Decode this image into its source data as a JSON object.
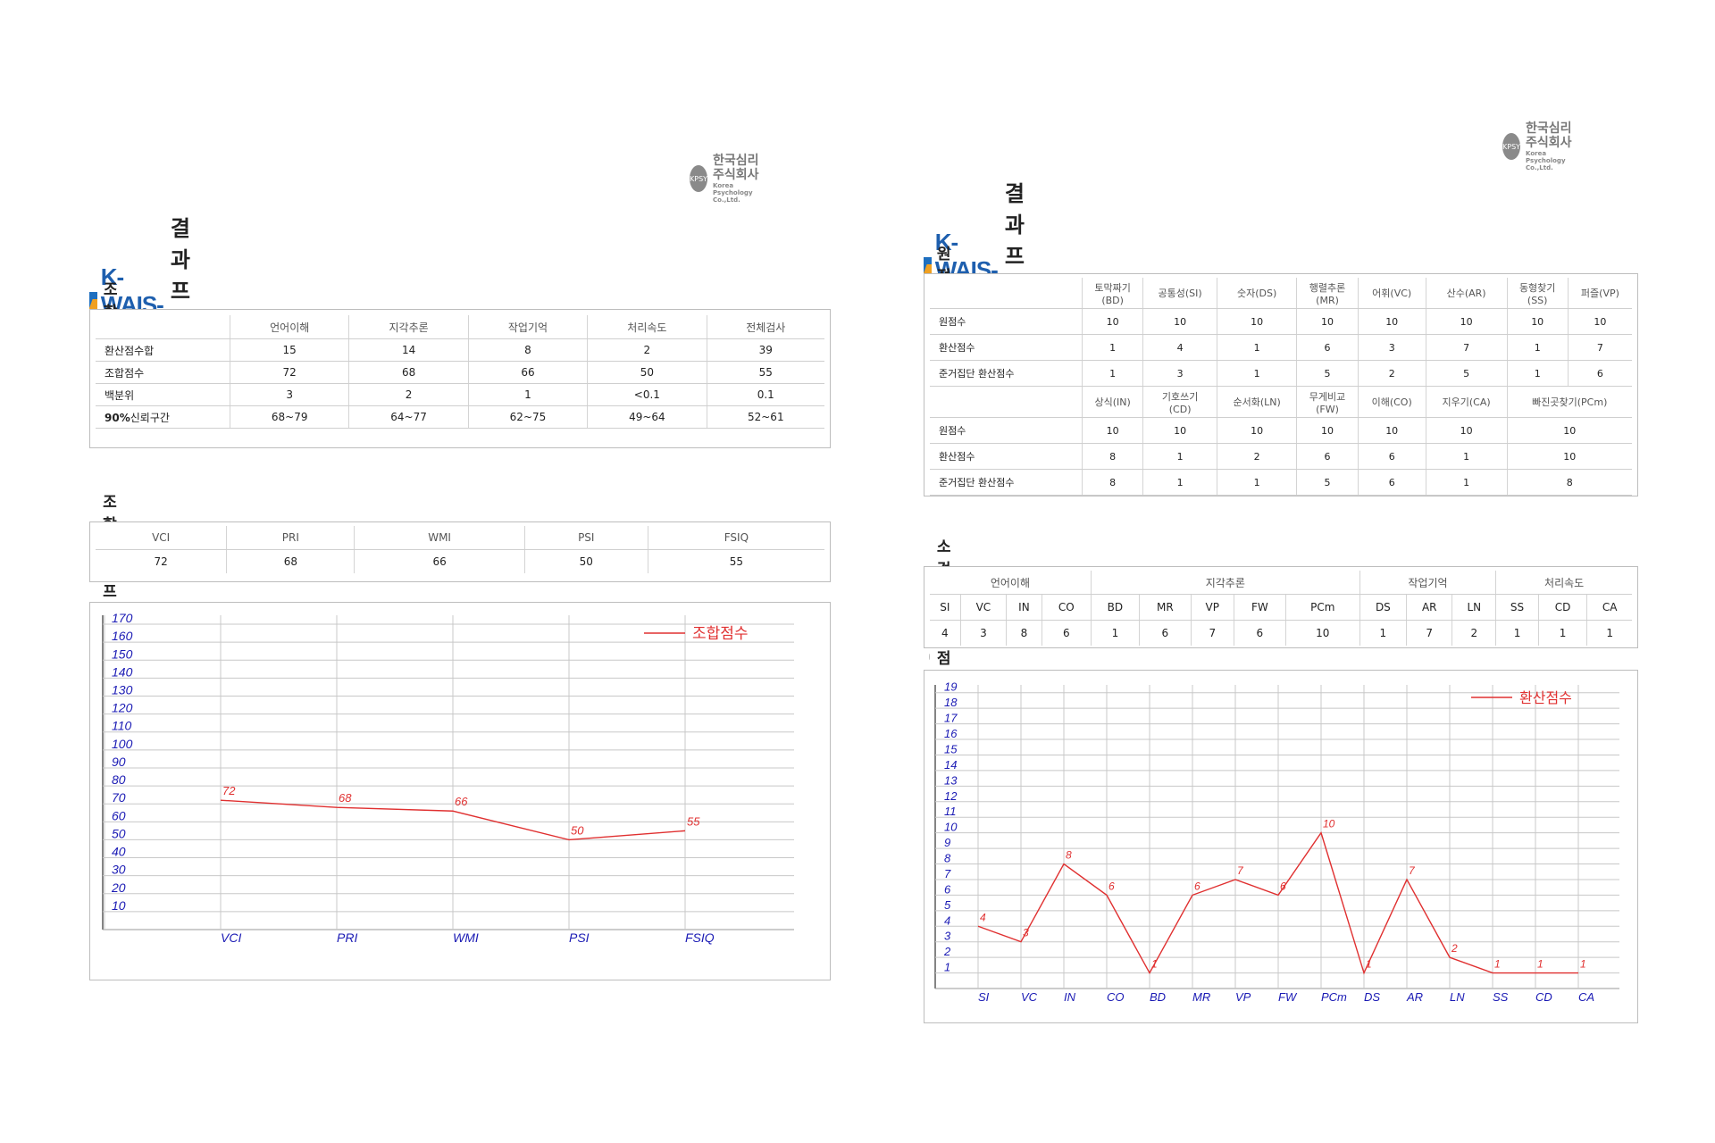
{
  "left": {
    "logo": {
      "ko": "한국심리주식회사",
      "en": "Korea Psychology Co.,Ltd.",
      "mark": "KPSY"
    },
    "title": {
      "brand": "K-WAIS-IV",
      "suffix": "결과프로파일"
    },
    "composite_table": {
      "section": "조합점수표",
      "columns": [
        "언어이해",
        "지각추론",
        "작업기억",
        "처리속도",
        "전체검사"
      ],
      "rows": [
        {
          "label": "환산점수합",
          "values": [
            "15",
            "14",
            "8",
            "2",
            "39"
          ]
        },
        {
          "label": "조합점수",
          "values": [
            "72",
            "68",
            "66",
            "50",
            "55"
          ]
        },
        {
          "label": "백분위",
          "values": [
            "3",
            "2",
            "1",
            "<0.1",
            "0.1"
          ]
        },
        {
          "label_bold": "90%",
          "label": "신뢰구간",
          "values": [
            "68~79",
            "64~77",
            "62~75",
            "49~64",
            "52~61"
          ]
        }
      ]
    },
    "profile_table": {
      "section": "조합점수 프로파일",
      "columns": [
        "VCI",
        "PRI",
        "WMI",
        "PSI",
        "FSIQ"
      ],
      "values": [
        "72",
        "68",
        "66",
        "50",
        "55"
      ]
    }
  },
  "right": {
    "logo": {
      "ko": "한국심리주식회사",
      "en": "Korea Psychology Co.,Ltd.",
      "mark": "KPSY"
    },
    "title": {
      "brand": "K-WAIS-IV",
      "suffix": "결과프로파일"
    },
    "conversion_table": {
      "section": "원점수의 환산점수 변환",
      "header1": [
        "토막짜기\n(BD)",
        "공통성(SI)",
        "숫자(DS)",
        "행렬추론\n(MR)",
        "어휘(VC)",
        "산수(AR)",
        "동형찾기\n(SS)",
        "퍼즐(VP)"
      ],
      "rows1": [
        {
          "label": "원점수",
          "values": [
            "10",
            "10",
            "10",
            "10",
            "10",
            "10",
            "10",
            "10"
          ]
        },
        {
          "label": "환산점수",
          "values": [
            "1",
            "4",
            "1",
            "6",
            "3",
            "7",
            "1",
            "7"
          ]
        },
        {
          "label": "준거집단 환산점수",
          "values": [
            "1",
            "3",
            "1",
            "5",
            "2",
            "5",
            "1",
            "6"
          ]
        }
      ],
      "header2": [
        "상식(IN)",
        "기호쓰기\n(CD)",
        "순서화(LN)",
        "무게비교\n(FW)",
        "이해(CO)",
        "지우기(CA)",
        "빠진곳찾기(PCm)"
      ],
      "rows2": [
        {
          "label": "원점수",
          "values": [
            "10",
            "10",
            "10",
            "10",
            "10",
            "10",
            "10"
          ]
        },
        {
          "label": "환산점수",
          "values": [
            "8",
            "1",
            "2",
            "6",
            "6",
            "1",
            "10"
          ]
        },
        {
          "label": "준거집단 환산점수",
          "values": [
            "8",
            "1",
            "1",
            "5",
            "6",
            "1",
            "8"
          ]
        }
      ]
    },
    "subtest_table": {
      "section": "소검사 환산점수 프로파일",
      "groups": [
        {
          "name": "언어이해",
          "span": 4
        },
        {
          "name": "지각추론",
          "span": 5
        },
        {
          "name": "작업기억",
          "span": 3
        },
        {
          "name": "처리속도",
          "span": 3
        }
      ],
      "columns": [
        "SI",
        "VC",
        "IN",
        "CO",
        "BD",
        "MR",
        "VP",
        "FW",
        "PCm",
        "DS",
        "AR",
        "LN",
        "SS",
        "CD",
        "CA"
      ],
      "values": [
        "4",
        "3",
        "8",
        "6",
        "1",
        "6",
        "7",
        "6",
        "10",
        "1",
        "7",
        "2",
        "1",
        "1",
        "1"
      ]
    }
  },
  "chart_data": [
    {
      "type": "line",
      "legend": "조합점수",
      "legend_position": "top-right",
      "categories": [
        "VCI",
        "PRI",
        "WMI",
        "PSI",
        "FSIQ"
      ],
      "series": [
        {
          "name": "조합점수",
          "values": [
            72,
            68,
            66,
            50,
            55
          ]
        }
      ],
      "yticks": [
        170,
        160,
        150,
        140,
        130,
        120,
        110,
        100,
        90,
        80,
        70,
        60,
        50,
        40,
        30,
        20,
        10
      ],
      "ylim": [
        0,
        175
      ],
      "grid": true,
      "color": "#e03030"
    },
    {
      "type": "line",
      "legend": "환산점수",
      "legend_position": "top-right",
      "categories": [
        "SI",
        "VC",
        "IN",
        "CO",
        "BD",
        "MR",
        "VP",
        "FW",
        "PCm",
        "DS",
        "AR",
        "LN",
        "SS",
        "CD",
        "CA"
      ],
      "series": [
        {
          "name": "환산점수",
          "values": [
            4,
            3,
            8,
            6,
            1,
            6,
            7,
            6,
            10,
            1,
            7,
            2,
            1,
            1,
            1
          ]
        }
      ],
      "yticks": [
        19,
        18,
        17,
        16,
        15,
        14,
        13,
        12,
        11,
        10,
        9,
        8,
        7,
        6,
        5,
        4,
        3,
        2,
        1
      ],
      "ylim": [
        0,
        19.5
      ],
      "grid": true,
      "color": "#e03030"
    }
  ]
}
